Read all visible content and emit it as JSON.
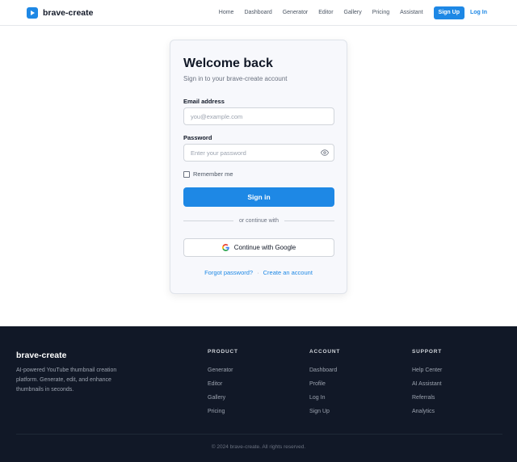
{
  "header": {
    "brand": "brave-create",
    "nav": [
      "Home",
      "Dashboard",
      "Generator",
      "Editor",
      "Gallery",
      "Pricing",
      "Assistant"
    ],
    "signup_label": "Sign Up",
    "login_label": "Log In"
  },
  "card": {
    "title": "Welcome back",
    "subtitle": "Sign in to your brave-create account",
    "email_label": "Email address",
    "email_placeholder": "you@example.com",
    "password_label": "Password",
    "password_placeholder": "Enter your password",
    "remember_label": "Remember me",
    "signin_label": "Sign in",
    "divider_text": "or continue with",
    "google_label": "Continue with Google",
    "forgot_label": "Forgot password?",
    "separator": "·",
    "create_label": "Create an account"
  },
  "footer": {
    "brand": "brave-create",
    "description": "AI-powered YouTube thumbnail creation platform. Generate, edit, and enhance thumbnails in seconds.",
    "columns": [
      {
        "heading": "PRODUCT",
        "items": [
          "Generator",
          "Editor",
          "Gallery",
          "Pricing"
        ]
      },
      {
        "heading": "ACCOUNT",
        "items": [
          "Dashboard",
          "Profile",
          "Log In",
          "Sign Up"
        ]
      },
      {
        "heading": "SUPPORT",
        "items": [
          "Help Center",
          "AI Assistant",
          "Referrals",
          "Analytics"
        ]
      }
    ],
    "copyright": "© 2024 brave-create. All rights reserved."
  },
  "colors": {
    "accent": "#1e88e5",
    "footer_bg": "#111827"
  }
}
